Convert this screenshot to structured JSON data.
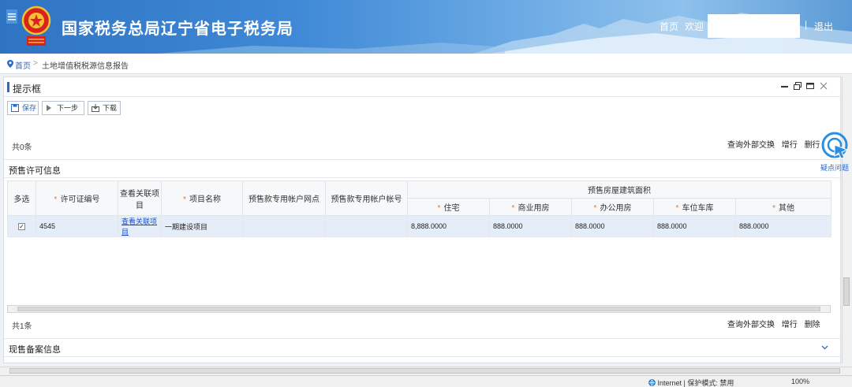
{
  "header": {
    "menu_icon": "menu-icon",
    "title": "国家税务总局辽宁省电子税务局",
    "home_link": "首页",
    "welcome": "欢迎",
    "separator": "|",
    "logout": "退出"
  },
  "breadcrumb": {
    "home": "首页",
    "separator": ">",
    "current": "土地增值税税源信息报告"
  },
  "panel": {
    "title": "提示框",
    "controls": [
      "minimize-icon",
      "restore-icon",
      "maximize-icon",
      "close-icon"
    ],
    "toolbar": {
      "save": "保存",
      "next": "下一步",
      "download": "下载"
    },
    "top_count": "共0条",
    "top_actions": {
      "query": "查询外部交换",
      "add": "增行",
      "delete": "删行"
    },
    "presale": {
      "title": "预售许可信息",
      "headers": {
        "multi_select": "多选",
        "permit_no": "许可证编号",
        "view_project": "查看关联项目",
        "project_name": "项目名称",
        "bank_branch": "预售款专用帐户网点",
        "bank_account": "预售款专用帐户帐号",
        "area_group": "预售房屋建筑面积",
        "residential": "住宅",
        "commercial": "商业用房",
        "office": "办公用房",
        "parking": "车位车库",
        "other": "其他"
      },
      "rows": [
        {
          "checked": true,
          "check_mark": "✓",
          "permit_no": "4545",
          "view_project": "查看关联项目",
          "project_name": "一期建设项目",
          "bank_branch": "",
          "bank_account": "",
          "residential": "8,888.0000",
          "commercial": "888.0000",
          "office": "888.0000",
          "parking": "888.0000",
          "other": "888.0000"
        }
      ],
      "count": "共1条",
      "actions": {
        "query": "查询外部交换",
        "add": "增行",
        "delete": "删除"
      }
    },
    "current_sale": {
      "title": "现售备案信息"
    }
  },
  "help_float": {
    "label": "疑点问题"
  },
  "statusbar": {
    "zone": "Internet | 保护模式: 禁用",
    "zoom": "100%"
  },
  "colors": {
    "brand_blue": "#2a6ac8",
    "required_star": "#e2762f",
    "selected_row": "#e5edf8"
  }
}
